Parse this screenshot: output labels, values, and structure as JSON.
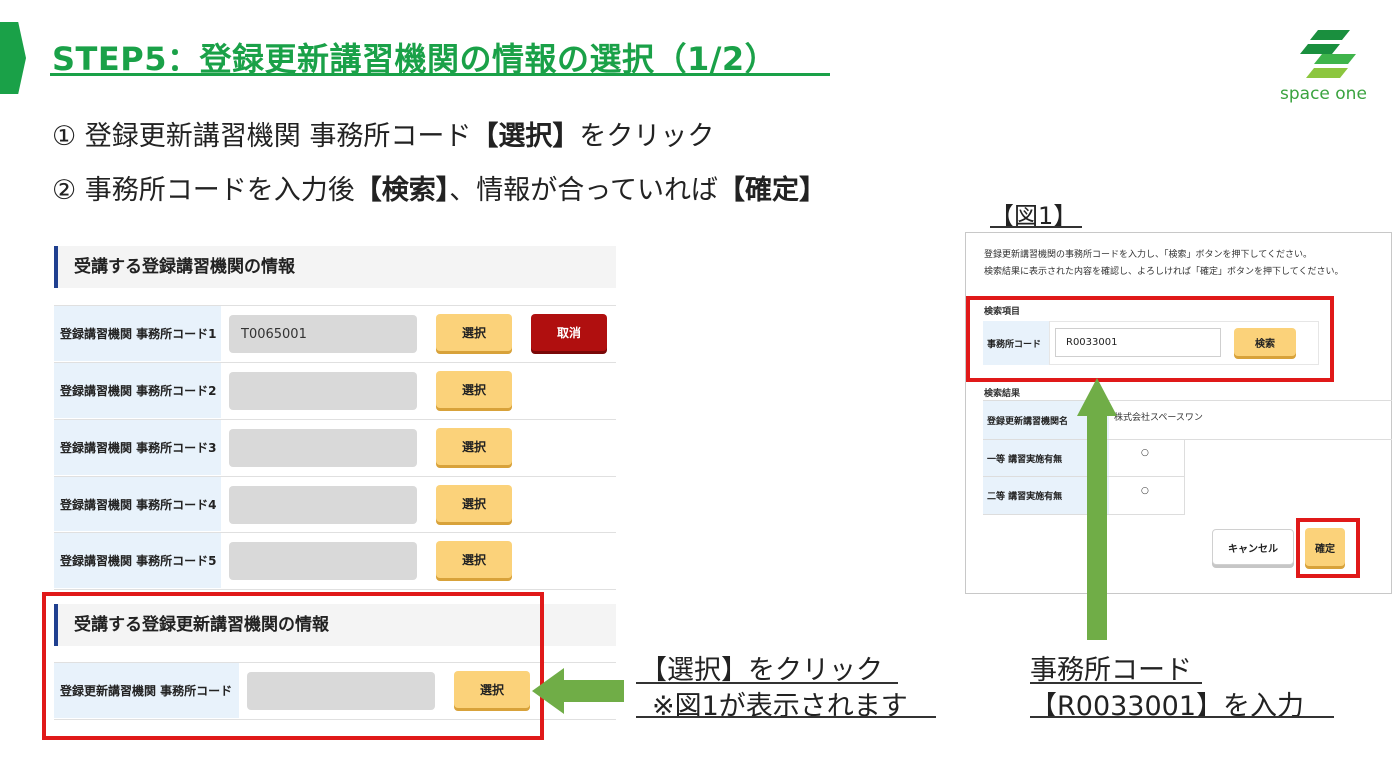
{
  "title": "STEP5：登録更新講習機関の情報の選択（1/2）",
  "logo": {
    "text": "space one",
    "color": "#3aa33f"
  },
  "instructions": {
    "step1_prefix": "① 登録更新講習機関 事務所コード",
    "step1_bold": "【選択】",
    "step1_suffix": "をクリック",
    "step2_prefix": "② 事務所コードを入力後",
    "step2_bold1": "【検索】",
    "step2_mid": "、情報が合っていれば",
    "step2_bold2": "【確定】"
  },
  "left_panel": {
    "section1_title": "受講する登録講習機関の情報",
    "rows": [
      {
        "label": "登録講習機関 事務所コード1",
        "value": "T0065001",
        "select_label": "選択",
        "cancel_label": "取消"
      },
      {
        "label": "登録講習機関 事務所コード2",
        "value": "",
        "select_label": "選択"
      },
      {
        "label": "登録講習機関 事務所コード3",
        "value": "",
        "select_label": "選択"
      },
      {
        "label": "登録講習機関 事務所コード4",
        "value": "",
        "select_label": "選択"
      },
      {
        "label": "登録講習機関 事務所コード5",
        "value": "",
        "select_label": "選択"
      }
    ],
    "section2_title": "受講する登録更新講習機関の情報",
    "renewal_row": {
      "label": "登録更新講習機関 事務所コード",
      "value": "",
      "select_label": "選択"
    }
  },
  "captions": {
    "left_line1": "【選択】をクリック",
    "left_line2": "※図1が表示されます",
    "right_line1": "事務所コード",
    "right_line2": "【R0033001】を入力"
  },
  "figure1": {
    "label": "【図1】",
    "instruction_line1": "登録更新講習機関の事務所コードを入力し、「検索」ボタンを押下してください。",
    "instruction_line2": "検索結果に表示された内容を確認し、よろしければ「確定」ボタンを押下してください。",
    "search_heading": "検索項目",
    "office_code_label": "事務所コード",
    "office_code_value": "R0033001",
    "search_button": "検索",
    "results_heading": "検索結果",
    "results": [
      {
        "label": "登録更新講習機関名",
        "value": "株式会社スペースワン"
      },
      {
        "label": "一等 講習実施有無",
        "value": "○"
      },
      {
        "label": "二等 講習実施有無",
        "value": "○"
      }
    ],
    "cancel_button": "キャンセル",
    "confirm_button": "確定"
  },
  "colors": {
    "accent_green": "#1aa148",
    "highlight_red": "#e01919",
    "arrow_green": "#70ad47",
    "button_yellow": "#fbd27a",
    "button_red": "#b00f0f"
  }
}
